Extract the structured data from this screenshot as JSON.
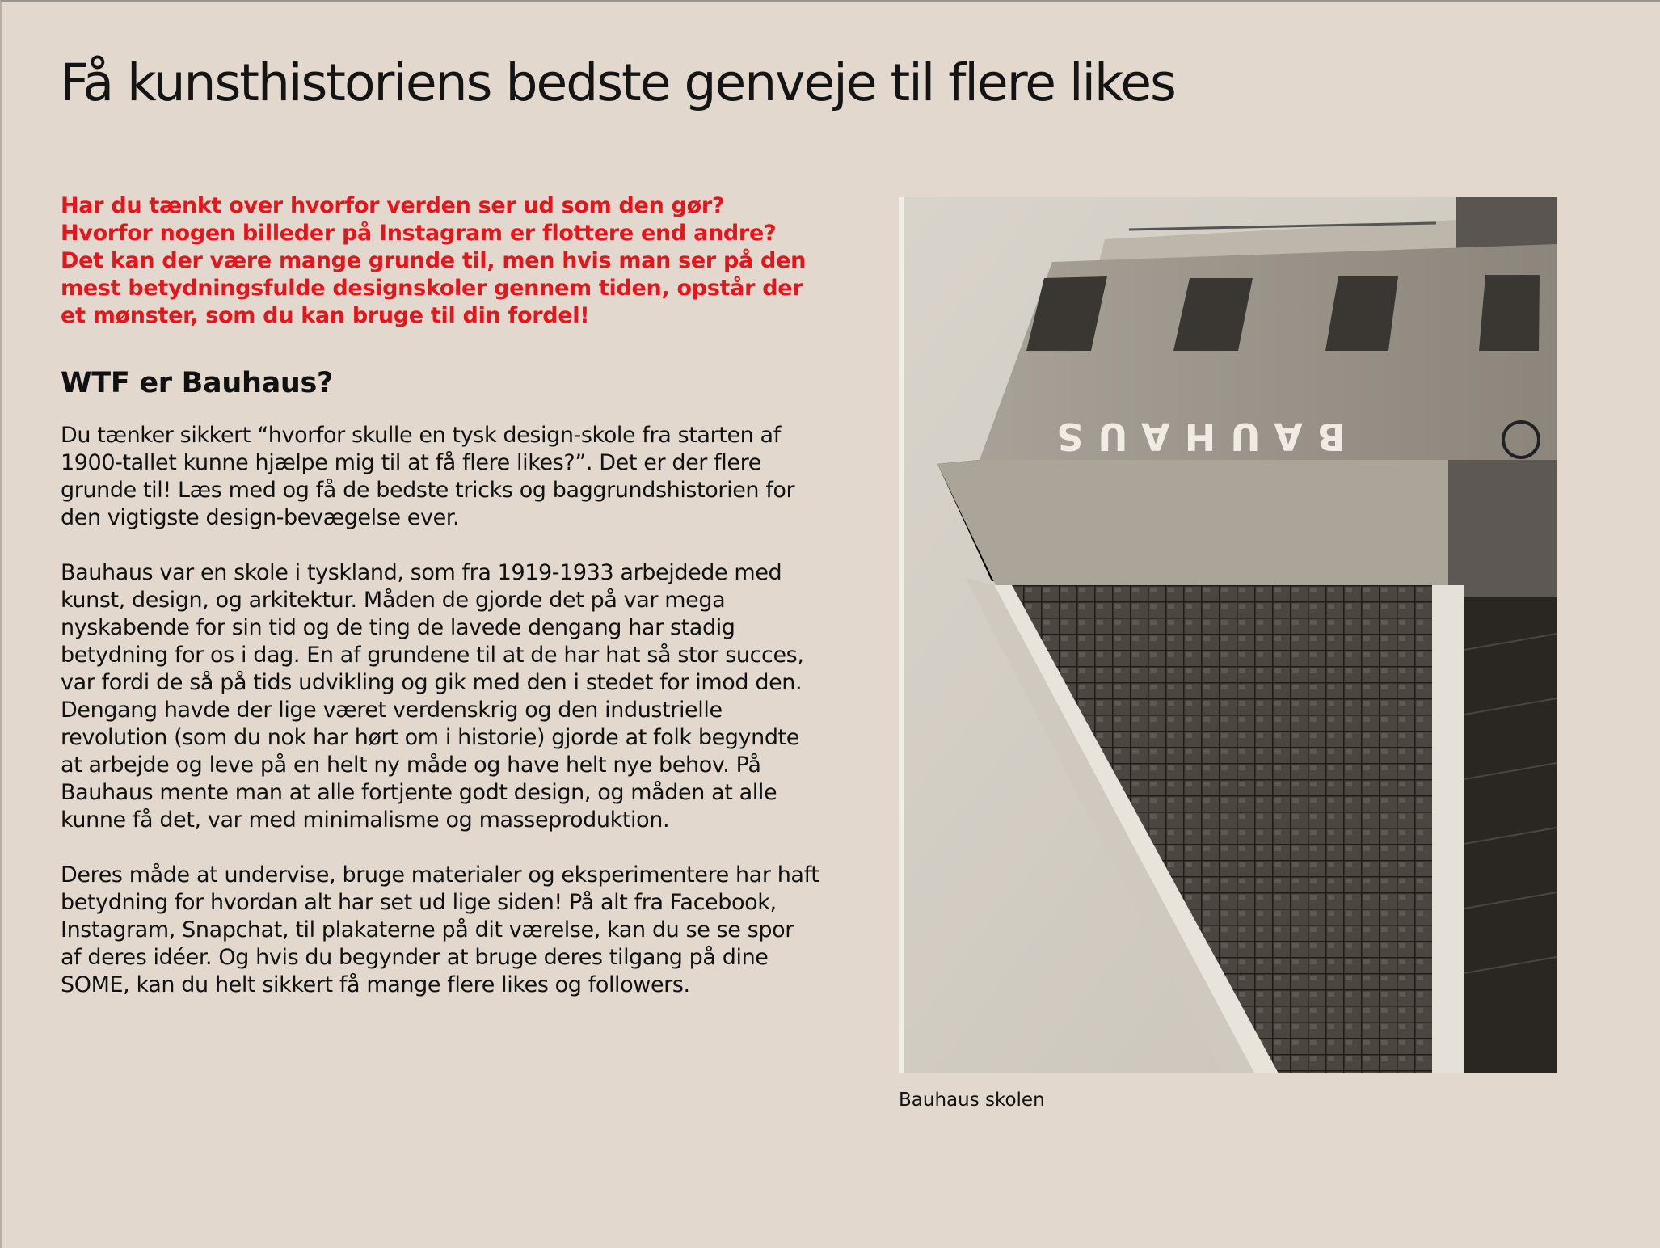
{
  "page": {
    "title": "Få kunsthistoriens bedste genveje til flere likes"
  },
  "intro": "Har du tænkt over hvorfor verden ser ud som den gør? Hvorfor nogen billeder på Instagram er flottere end andre? Det kan der være mange grunde til, men hvis man ser på den mest betydningsfulde designskoler gennem tiden, opstår der et mønster, som du kan bruge til din fordel!",
  "section": {
    "heading": "WTF er Bauhaus?",
    "paragraphs": [
      "Du tænker sikkert “hvorfor skulle en tysk design-skole fra starten af 1900-tallet kunne hjælpe mig til at få flere likes?”. Det er der flere grunde til! Læs med og få de bedste tricks og baggrundshistorien for den vigtigste design-bevægelse ever.",
      "Bauhaus var en skole i tyskland, som fra 1919-1933 arbejdede med kunst, design, og arkitektur. Måden de gjorde det på var mega nyskabende for sin tid og de ting de lavede dengang har stadig betydning for os i dag. En af grundene til at de har hat så stor succes, var fordi de så på tids udvikling og gik med den i stedet for imod den. Dengang havde der lige været verdenskrig og den industrielle revolution (som du nok har hørt om i historie) gjorde at folk begyndte at arbejde og leve på en helt ny måde og have helt nye behov. På Bauhaus mente man at alle fortjente godt design, og måden at alle kunne få det, var med minimalisme og masseproduktion.",
      "Deres måde at undervise, bruge materialer og eksperimentere har haft betydning for hvordan alt har set ud lige siden! På alt fra Facebook, Instagram, Snapchat, til plakaterne på dit værelse, kan du se se spor af deres idéer. Og hvis du begynder at bruge deres tilgang på dine SOME, kan du helt sikkert få mange flere likes og followers."
    ]
  },
  "figure": {
    "sign_text": "BAUHAUS",
    "caption": "Bauhaus skolen"
  },
  "colors": {
    "background": "#e2d8cd",
    "lead": "#e4161b",
    "text": "#111111"
  }
}
